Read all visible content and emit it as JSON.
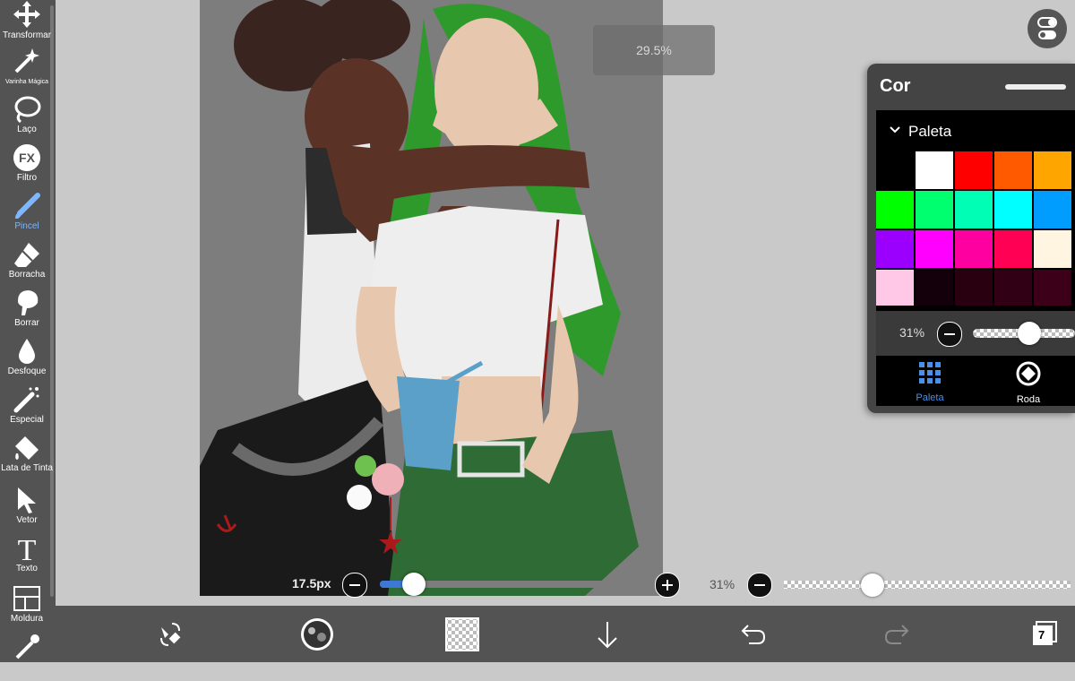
{
  "toolbar": {
    "tools": [
      {
        "label": "Transformar",
        "icon": "move-arrows-icon"
      },
      {
        "label": "Varinha Mágica",
        "icon": "magic-wand-icon"
      },
      {
        "label": "Laço",
        "icon": "lasso-icon"
      },
      {
        "label": "Filtro",
        "icon": "fx-icon"
      },
      {
        "label": "Pincel",
        "icon": "brush-icon"
      },
      {
        "label": "Borracha",
        "icon": "eraser-icon"
      },
      {
        "label": "Borrar",
        "icon": "smudge-icon"
      },
      {
        "label": "Desfoque",
        "icon": "blur-drop-icon"
      },
      {
        "label": "Especial",
        "icon": "special-brush-icon"
      },
      {
        "label": "Lata de Tinta",
        "icon": "paint-bucket-icon"
      },
      {
        "label": "Vetor",
        "icon": "vector-cursor-icon"
      },
      {
        "label": "Texto",
        "icon": "text-icon"
      },
      {
        "label": "Moldura",
        "icon": "frame-icon"
      },
      {
        "label": "",
        "icon": "eyedropper-icon"
      }
    ],
    "active_tool": "Pincel"
  },
  "canvas": {
    "zoom_label": "29.5%"
  },
  "color_panel": {
    "title": "Cor",
    "palette_label": "Paleta",
    "opacity_label": "31%",
    "opacity_value": 0.31,
    "swatches_row1": [
      "#000000",
      "#ffffff",
      "#ff0000",
      "#ff5a00",
      "#ffa500"
    ],
    "swatches_row2": [
      "#00ff00",
      "#00ff6e",
      "#00ffb4",
      "#00ffff",
      "#009dff"
    ],
    "swatches_row3": [
      "#9b00ff",
      "#ff00ff",
      "#ff00a0",
      "#ff0055",
      "#fff5e0"
    ],
    "swatches_row4": [
      "#ffc8e6",
      "#14000a",
      "#28000f",
      "#320014",
      "#3c0019"
    ],
    "tabs": [
      {
        "label": "Paleta",
        "icon": "grid-icon",
        "active": true
      },
      {
        "label": "Roda",
        "icon": "color-wheel-icon",
        "active": false
      }
    ]
  },
  "brush": {
    "size_label": "17.5px",
    "size_fraction": 0.13
  },
  "layer_opacity": {
    "label": "31%",
    "fraction": 0.31
  },
  "bottombar": {
    "layer_count": "7"
  },
  "colors": {
    "accent": "#3e78d6",
    "active_label": "#7db7ff",
    "toolbar_bg": "#535353",
    "canvas_bg": "#c9c9c9"
  }
}
